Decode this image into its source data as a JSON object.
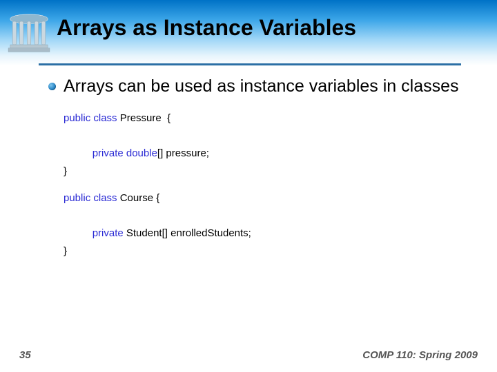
{
  "title": "Arrays as Instance Variables",
  "bullet": "Arrays can be used as instance variables in classes",
  "code1": {
    "l1_a": "public class",
    "l1_b": " Pressure  {",
    "l2_a": "private double",
    "l2_b": "[] pressure;",
    "l3": "}"
  },
  "code2": {
    "l1_a": "public class",
    "l1_b": " Course {",
    "l2_a": "private",
    "l2_b": " Student[] enrolledStudents;",
    "l3": "}"
  },
  "slide_number": "35",
  "footer": "COMP 110: Spring 2009"
}
